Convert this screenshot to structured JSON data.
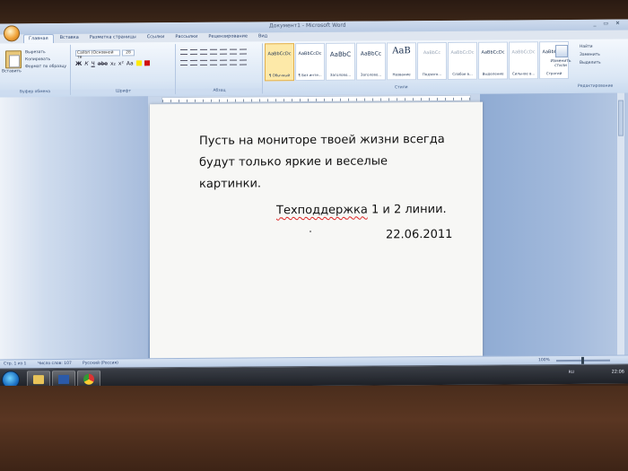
{
  "window": {
    "title": "Документ1 - Microsoft Word",
    "controls": "_ ▭ ✕"
  },
  "ribbon": {
    "tabs": [
      "Главная",
      "Вставка",
      "Разметка страницы",
      "Ссылки",
      "Рассылки",
      "Рецензирование",
      "Вид"
    ],
    "active_tab": "Главная",
    "clipboard": {
      "paste": "Вставить",
      "cut": "Вырезать",
      "copy": "Копировать",
      "format_painter": "Формат по образцу",
      "group": "Буфер обмена"
    },
    "font": {
      "name": "Calibri (Основной те",
      "size": "28",
      "bold": "Ж",
      "italic": "К",
      "underline": "Ч",
      "strike": "abe",
      "sub": "x₂",
      "sup": "x²",
      "case": "Aa",
      "group": "Шрифт"
    },
    "paragraph": {
      "group": "Абзац"
    },
    "styles": {
      "group": "Стили",
      "items": [
        {
          "sample": "AaBbCcDc",
          "name": "¶ Обычный"
        },
        {
          "sample": "AaBbCcDc",
          "name": "¶ Без инте..."
        },
        {
          "sample": "AaBbC",
          "name": "Заголово..."
        },
        {
          "sample": "AaBbCc",
          "name": "Заголово..."
        },
        {
          "sample": "AaB",
          "name": "Название"
        },
        {
          "sample": "AaBbCc",
          "name": "Подзаго..."
        },
        {
          "sample": "AaBbCcDc",
          "name": "Слабое в..."
        },
        {
          "sample": "AaBbCcDc",
          "name": "Выделение"
        },
        {
          "sample": "AaBbCcDc",
          "name": "Сильное в..."
        },
        {
          "sample": "AaBbCcDc",
          "name": "Строгий"
        }
      ],
      "change_styles": "Изменить стили"
    },
    "editing": {
      "find": "Найти",
      "replace": "Заменить",
      "select": "Выделить",
      "group": "Редактирование"
    }
  },
  "document": {
    "line1": "Пусть на мониторе твоей жизни всегда",
    "line2": "будут только яркие и веселые",
    "line3": "картинки.",
    "signature_word": "Техподдержка",
    "signature_rest": " 1 и  2 линии.",
    "date": "22.06.2011"
  },
  "statusbar": {
    "page": "Стр. 1 из 1",
    "words": "Число слов: 107",
    "language": "Русский (Россия)",
    "zoom": "100%"
  },
  "taskbar": {
    "apps": [
      "explorer-icon",
      "word-icon",
      "chrome-icon"
    ],
    "lang": "RU",
    "time": "22:06"
  }
}
